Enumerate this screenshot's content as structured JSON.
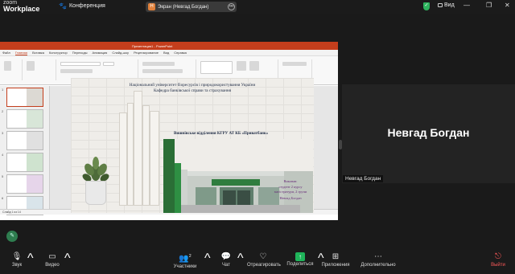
{
  "app": {
    "logo_line1": "zoom",
    "logo_line2": "Workplace",
    "conference_label": "Конференция",
    "screen_share_badge": "Н",
    "screen_share_label": "Экран (Невгад Богдан)",
    "view_label": "Вид"
  },
  "powerpoint": {
    "window_title": "Презентация1 - PowerPoint",
    "tabs": [
      "Файл",
      "Главная",
      "Вставка",
      "Конструктор",
      "Переходы",
      "Анимация",
      "Слайд-шоу",
      "Рецензирование",
      "Вид",
      "Справка"
    ],
    "active_tab": "Главная",
    "slide_count_label": "Слайд 1 из 14",
    "thumb_numbers": [
      "1",
      "2",
      "3",
      "4",
      "5",
      "6"
    ]
  },
  "slide": {
    "line1": "Національний університет біоресурсів і природокористування України",
    "line2": "Кафедра банківської справи та страхування",
    "bank_title": "Вишнівське відділення КГРУ АТ КБ «Приватбанк»",
    "right_lines": [
      "Виконав:",
      "студент 2 курсу",
      "магістратури, 2 групи",
      "Невгад Богдан"
    ]
  },
  "participant": {
    "name": "Невгад Богдан",
    "label": "Невгад Богдан"
  },
  "toolbar": {
    "audio": "Звук",
    "video": "Видео",
    "participants": "Участники",
    "participants_count": "2",
    "chat": "Чат",
    "react": "Отреагировать",
    "share": "Поделиться",
    "apps": "Приложения",
    "more": "Дополнительно",
    "leave": "Выйти"
  }
}
